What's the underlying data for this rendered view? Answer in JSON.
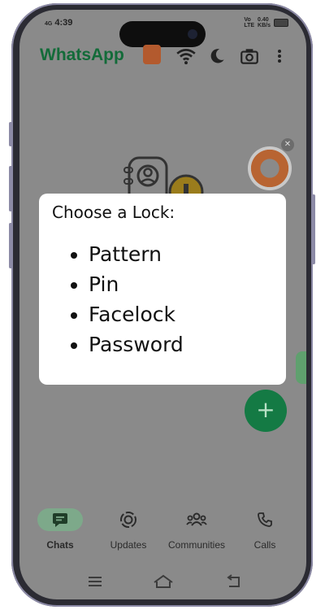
{
  "status_bar": {
    "time": "4:39",
    "net_speed": "0.40",
    "net_unit": "KB/s",
    "vol_label": "Vo",
    "lte_label": "LTE",
    "signal_label": "4G"
  },
  "app_bar": {
    "title": "WhatsApp",
    "icons": [
      "sticker-icon",
      "wifi-icon",
      "moon-icon",
      "camera-icon",
      "more-vert-icon"
    ]
  },
  "colors": {
    "title_green": "#136b39",
    "fab_green": "#147a44",
    "active_pill": "#7da98a",
    "overlay_grey": "#8a8a8a"
  },
  "modal": {
    "heading": "Choose a Lock:",
    "options": [
      "Pattern",
      "Pin",
      "Facelock",
      "Password"
    ]
  },
  "fab": {
    "symbol": "+"
  },
  "bottom_nav": {
    "items": [
      {
        "label": "Chats",
        "icon": "chat-icon",
        "active": true
      },
      {
        "label": "Updates",
        "icon": "updates-icon",
        "active": false
      },
      {
        "label": "Communities",
        "icon": "communities-icon",
        "active": false
      },
      {
        "label": "Calls",
        "icon": "phone-icon",
        "active": false
      }
    ]
  },
  "system_nav": {
    "icons": [
      "menu-icon",
      "home-icon",
      "back-icon"
    ]
  }
}
